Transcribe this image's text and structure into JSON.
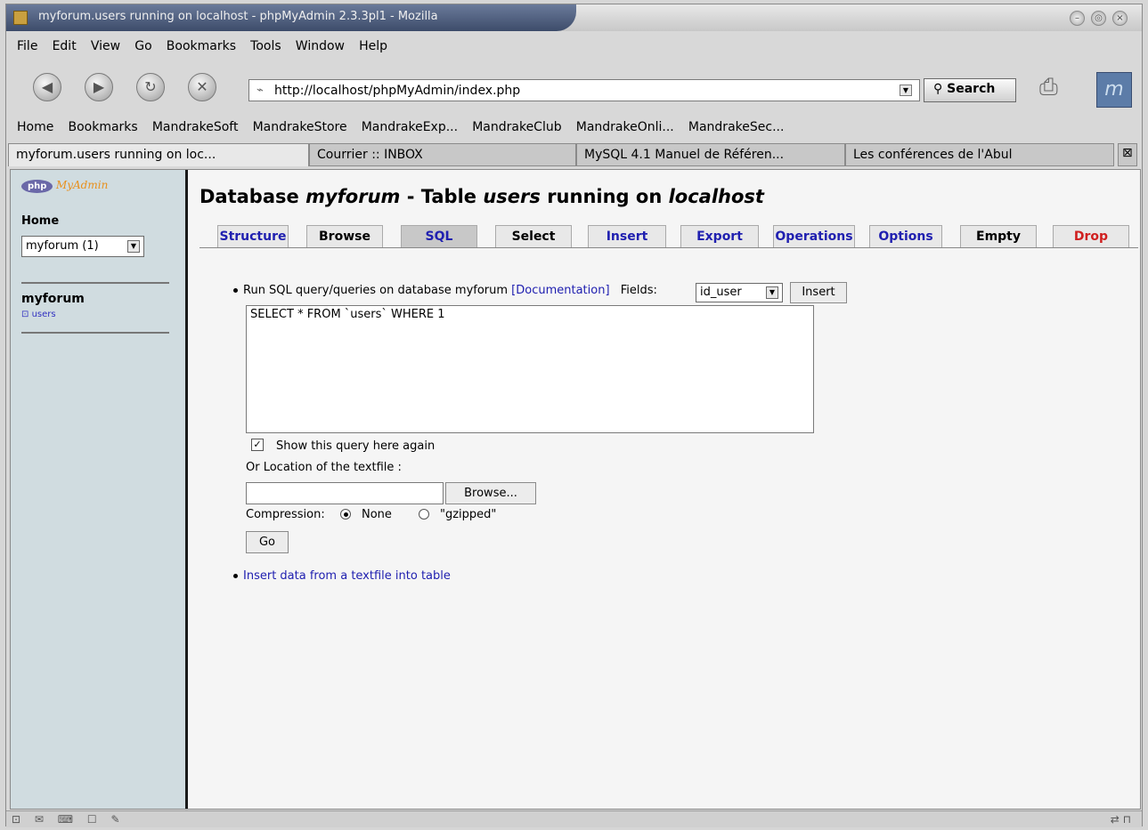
{
  "window": {
    "title": "myforum.users running on localhost - phpMyAdmin 2.3.3pl1 - Mozilla"
  },
  "menu": [
    "File",
    "Edit",
    "View",
    "Go",
    "Bookmarks",
    "Tools",
    "Window",
    "Help"
  ],
  "nav": {
    "url": "http://localhost/phpMyAdmin/index.php",
    "search_label": "Search"
  },
  "bookmarks": [
    "Home",
    "Bookmarks",
    "MandrakeSoft",
    "MandrakeStore",
    "MandrakeExp...",
    "MandrakeClub",
    "MandrakeOnli...",
    "MandrakeSec..."
  ],
  "browser_tabs": [
    "myforum.users running on loc...",
    "Courrier :: INBOX",
    "MySQL 4.1 Manuel de Référen...",
    "Les conférences de l'Abul"
  ],
  "sidebar": {
    "logo_php": "php",
    "logo_myadmin": "MyAdmin",
    "home": "Home",
    "db_select": "myforum (1)",
    "db_name": "myforum",
    "table_name": "users"
  },
  "main": {
    "title_prefix": "Database ",
    "title_db": "myforum",
    "title_mid": " - Table ",
    "title_table": "users",
    "title_mid2": " running on ",
    "title_host": "localhost",
    "tabs": [
      "Structure",
      "Browse",
      "SQL",
      "Select",
      "Insert",
      "Export",
      "Operations",
      "Options",
      "Empty",
      "Drop"
    ],
    "run_text": "Run SQL query/queries on database myforum ",
    "documentation": "[Documentation]",
    "fields_label": "Fields:",
    "fields_value": "id_user",
    "insert_button": "Insert",
    "sql_query": "SELECT * FROM `users` WHERE 1",
    "show_again": "Show this query here again",
    "or_location": "Or Location of the textfile :",
    "browse_button": "Browse...",
    "compression_label": "Compression:",
    "none_label": "None",
    "gzipped_label": "\"gzipped\"",
    "go_button": "Go",
    "insert_textfile_link": "Insert data from a textfile into table"
  }
}
